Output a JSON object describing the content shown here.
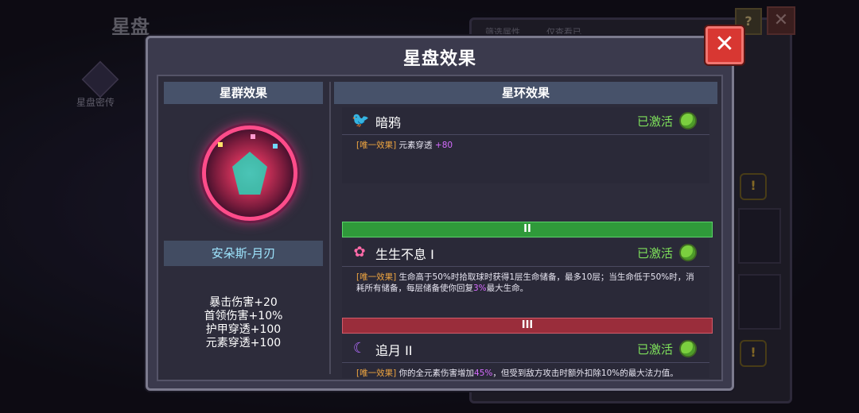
{
  "background": {
    "title": "星盘",
    "side_item": "星盘密传",
    "tabs": [
      "筛选属性",
      "仅查看已"
    ]
  },
  "modal": {
    "title": "星盘效果",
    "close_label": "✕"
  },
  "left": {
    "header": "星群效果",
    "hero_name": "安朵斯-月刃",
    "stats": [
      "暴击伤害+20",
      "首领伤害+10%",
      "护甲穿透+100",
      "元素穿透+100"
    ]
  },
  "right": {
    "header": "星环效果",
    "tier2": "II",
    "tier3": "III",
    "entries": [
      {
        "icon": "🐦",
        "name": "暗鸦",
        "status": "已激活",
        "tag": "[唯一效果]",
        "text": " 元素穿透 ",
        "highlight": "+80",
        "text_after": ""
      },
      {
        "icon": "✿",
        "name": "生生不息 I",
        "status": "已激活",
        "tag": "[唯一效果]",
        "text": " 生命高于50%时拾取球时获得1层生命储备，最多10层；当生命低于50%时，消耗所有储备，每层储备使你回复",
        "highlight": "3%",
        "text_after": "最大生命。"
      },
      {
        "icon": "☾",
        "name": "追月 II",
        "status": "已激活",
        "tag": "[唯一效果]",
        "text": " 你的全元素伤害增加",
        "highlight": "45%",
        "text_after": "，但受到敌方攻击时额外扣除10%的最大法力值。"
      }
    ]
  },
  "colors": {
    "active_green": "#7ee05b",
    "tag_orange": "#f0a640",
    "highlight_purple": "#d66cff",
    "close_red": "#d83732"
  }
}
